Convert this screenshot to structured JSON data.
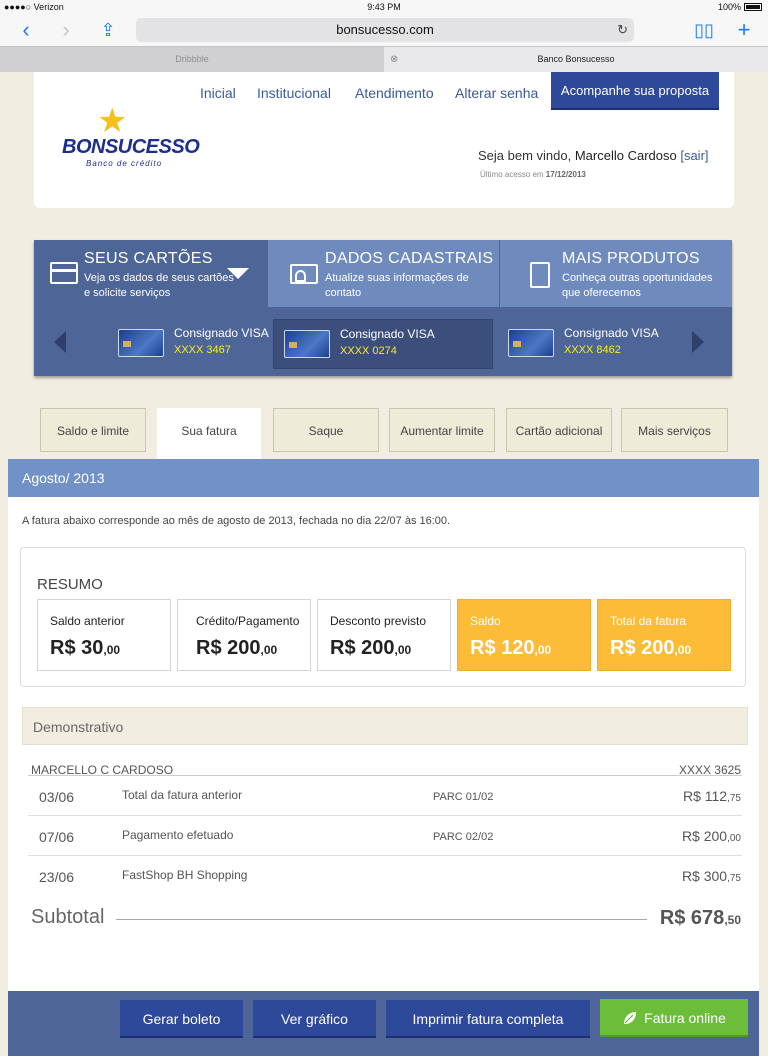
{
  "statusbar": {
    "carrier": "●●●●○ Verizon",
    "time": "9:43 PM",
    "battery": "100%"
  },
  "browser": {
    "url": "bonsucesso.com",
    "tabs": [
      {
        "label": "Dribbble"
      },
      {
        "label": "Banco Bonsucesso"
      }
    ]
  },
  "header": {
    "logo_name": "BONSUCESSO",
    "logo_sub": "Banco de crédito",
    "nav": [
      "Inicial",
      "Institucional",
      "Atendimento",
      "Alterar senha"
    ],
    "cta": "Acompanhe sua proposta",
    "welcome_prefix": "Seja bem vindo, ",
    "user_name": "Marcello Cardoso",
    "logout": "[sair]",
    "last_access_label": "Último acesso em ",
    "last_access_date": "17/12/2013"
  },
  "panel": {
    "tabs": [
      {
        "title": "SEUS CARTÕES",
        "subtitle": "Veja os dados de seus cartões e solicite serviços"
      },
      {
        "title": "DADOS CADASTRAIS",
        "subtitle": "Atualize suas informações de contato"
      },
      {
        "title": "MAIS PRODUTOS",
        "subtitle": "Conheça outras oportunidades que oferecemos"
      }
    ],
    "cards": [
      {
        "name": "Consignado VISA",
        "number": "XXXX 3467"
      },
      {
        "name": "Consignado VISA",
        "number": "XXXX 0274"
      },
      {
        "name": "Consignado VISA",
        "number": "XXXX 8462"
      }
    ]
  },
  "section_tabs": [
    "Saldo e limite",
    "Sua fatura",
    "Saque",
    "Aumentar limite",
    "Cartão adicional",
    "Mais serviços"
  ],
  "invoice": {
    "month": "Agosto/ 2013",
    "intro": "A fatura abaixo corresponde ao mês de agosto de 2013, fechada no dia 22/07 às 16:00.",
    "resumo_title": "RESUMO",
    "resumo": [
      {
        "label": "Saldo anterior",
        "value": "R$ 30",
        "cents": ",00"
      },
      {
        "label": "Crédito/Pagamento",
        "value": "R$ 200",
        "cents": ",00"
      },
      {
        "label": "Desconto previsto",
        "value": "R$ 200",
        "cents": ",00"
      },
      {
        "label": "Saldo",
        "value": "R$ 120",
        "cents": ",00"
      },
      {
        "label": "Total da fatura",
        "value": "R$ 200",
        "cents": ",00"
      }
    ],
    "demonstrativo_title": "Demonstrativo",
    "owner": "MARCELLO C CARDOSO",
    "owner_card": "XXXX 3625",
    "transactions": [
      {
        "date": "03/06",
        "desc": "Total da fatura anterior",
        "parc": "PARC 01/02",
        "amount": "R$ 112",
        "cents": ",75"
      },
      {
        "date": "07/06",
        "desc": "Pagamento efetuado",
        "parc": "PARC 02/02",
        "amount": "R$ 200",
        "cents": ",00"
      },
      {
        "date": "23/06",
        "desc": "FastShop BH Shopping",
        "parc": "",
        "amount": "R$ 300",
        "cents": ",75"
      }
    ],
    "subtotal_label": "Subtotal",
    "subtotal_value": "R$ 678",
    "subtotal_cents": ",50"
  },
  "footer": {
    "buttons": [
      "Gerar boleto",
      "Ver gráfico",
      "Imprimir fatura completa",
      "Fatura online"
    ]
  },
  "colors": {
    "brand_blue": "#2e4999",
    "panel_blue": "#4d6597",
    "highlight": "#fcbc37",
    "green": "#6cbe3a"
  }
}
